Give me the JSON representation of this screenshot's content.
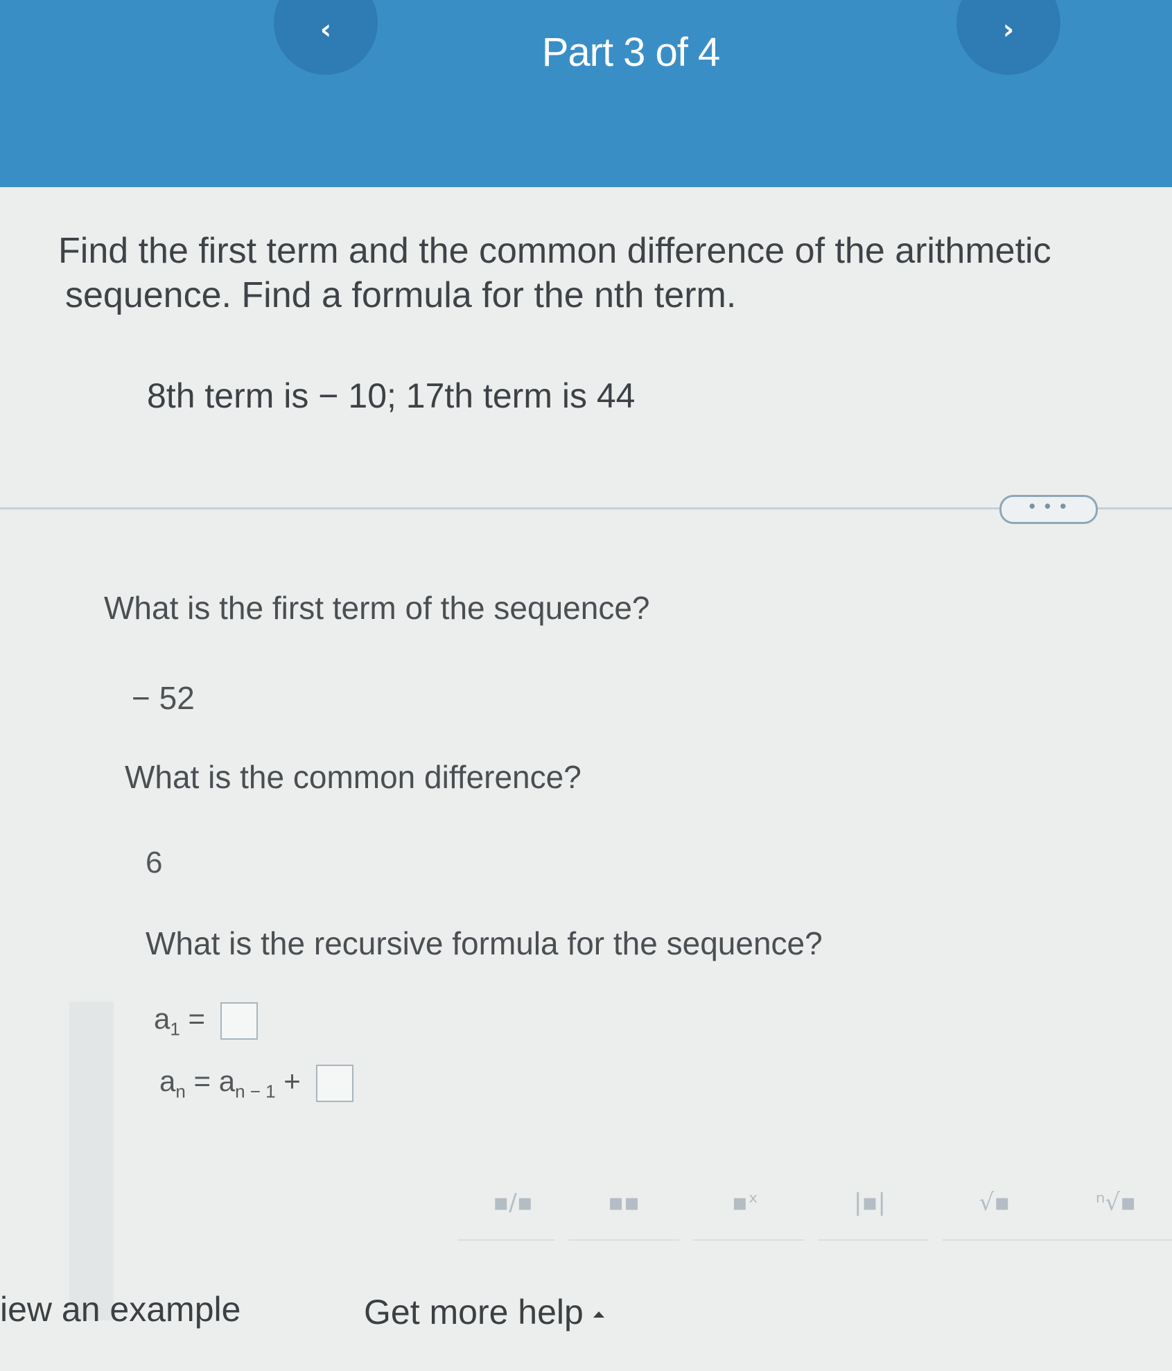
{
  "header": {
    "part_label": "Part 3 of 4",
    "prev_icon": "‹",
    "next_icon": "›"
  },
  "problem": {
    "prompt_line1": "Find the first term and the common difference of the arithmetic",
    "prompt_line2": "sequence. Find a formula for the nth term.",
    "given": "8th term is  − 10;  17th term is 44"
  },
  "more_button": "• • •",
  "questions": [
    {
      "text": "What is the first term of the sequence?",
      "answer": "− 52"
    },
    {
      "text": "What is the common difference?",
      "answer": "6"
    },
    {
      "text": "What is the recursive formula for the sequence?"
    }
  ],
  "recursive": {
    "a1_label": "a",
    "a1_sub": "1",
    "eq": "=",
    "an_label": "a",
    "an_sub": "n",
    "prev_label": "a",
    "prev_sub": "n − 1",
    "plus": "+"
  },
  "toolbar": [
    {
      "icon": "fraction-icon",
      "glyph": "▪∕▪"
    },
    {
      "icon": "mixed-number-icon",
      "glyph": "▪▪"
    },
    {
      "icon": "exponent-icon",
      "glyph": "▪ˣ"
    },
    {
      "icon": "absolute-value-icon",
      "glyph": "|▪|"
    },
    {
      "icon": "square-root-icon",
      "glyph": "√▪"
    },
    {
      "icon": "nth-root-icon",
      "glyph": "ⁿ√▪"
    }
  ],
  "footer": {
    "view_example": "iew an example",
    "get_help": "Get more help"
  }
}
